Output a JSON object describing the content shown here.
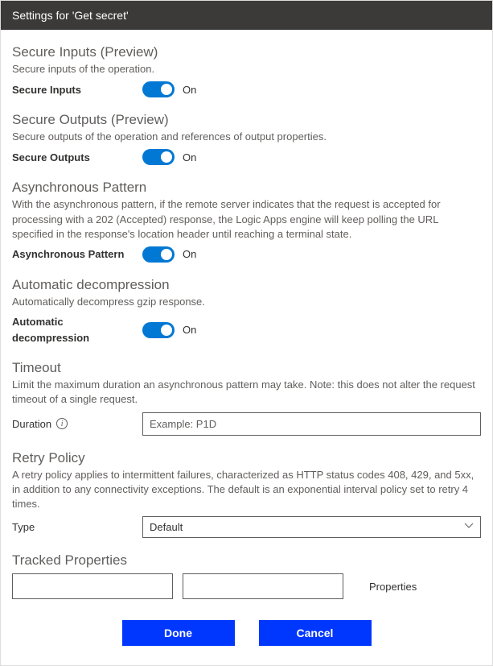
{
  "header": {
    "title": "Settings for 'Get secret'"
  },
  "sections": {
    "secureInputs": {
      "title": "Secure Inputs (Preview)",
      "desc": "Secure inputs of the operation.",
      "label": "Secure Inputs",
      "state": "On"
    },
    "secureOutputs": {
      "title": "Secure Outputs (Preview)",
      "desc": "Secure outputs of the operation and references of output properties.",
      "label": "Secure Outputs",
      "state": "On"
    },
    "asyncPattern": {
      "title": "Asynchronous Pattern",
      "desc": "With the asynchronous pattern, if the remote server indicates that the request is accepted for processing with a 202 (Accepted) response, the Logic Apps engine will keep polling the URL specified in the response's location header until reaching a terminal state.",
      "label": "Asynchronous Pattern",
      "state": "On"
    },
    "autoDecompress": {
      "title": "Automatic decompression",
      "desc": "Automatically decompress gzip response.",
      "label": "Automatic decompression",
      "state": "On"
    },
    "timeout": {
      "title": "Timeout",
      "desc": "Limit the maximum duration an asynchronous pattern may take. Note: this does not alter the request timeout of a single request.",
      "label": "Duration",
      "placeholder": "Example: P1D"
    },
    "retry": {
      "title": "Retry Policy",
      "desc": "A retry policy applies to intermittent failures, characterized as HTTP status codes 408, 429, and 5xx, in addition to any connectivity exceptions. The default is an exponential interval policy set to retry 4 times.",
      "label": "Type",
      "value": "Default"
    },
    "tracked": {
      "title": "Tracked Properties",
      "propsLabel": "Properties"
    }
  },
  "buttons": {
    "done": "Done",
    "cancel": "Cancel"
  }
}
